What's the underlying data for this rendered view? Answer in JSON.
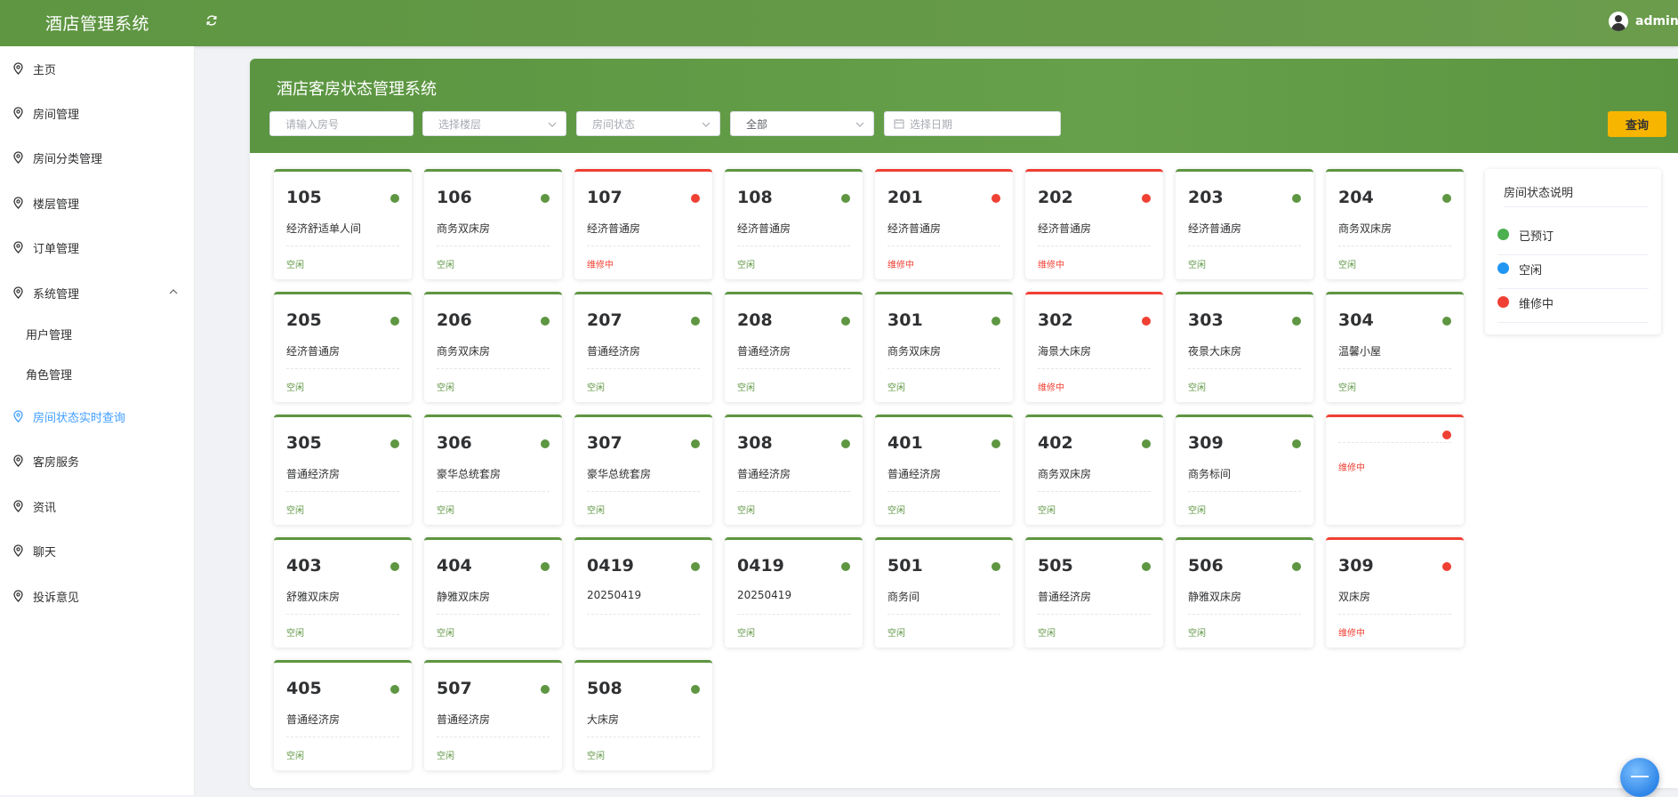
{
  "header": {
    "app_title": "酒店管理系统",
    "username": "admin"
  },
  "sidebar": {
    "items": [
      {
        "label": "主页",
        "active": false
      },
      {
        "label": "房间管理",
        "active": false
      },
      {
        "label": "房间分类管理",
        "active": false
      },
      {
        "label": "楼层管理",
        "active": false
      },
      {
        "label": "订单管理",
        "active": false
      },
      {
        "label": "系统管理",
        "active": false,
        "expanded": true
      },
      {
        "label": "用户管理",
        "active": false,
        "sub": true
      },
      {
        "label": "角色管理",
        "active": false,
        "sub": true
      },
      {
        "label": "房间状态实时查询",
        "active": true
      },
      {
        "label": "客房服务",
        "active": false
      },
      {
        "label": "资讯",
        "active": false
      },
      {
        "label": "聊天",
        "active": false
      },
      {
        "label": "投诉意见",
        "active": false
      }
    ]
  },
  "main": {
    "title": "酒店客房状态管理系统",
    "filters": {
      "room_number_placeholder": "请输入房号",
      "floor_placeholder": "选择楼层",
      "status_placeholder": "房间状态",
      "type_value": "全部",
      "date_placeholder": "选择日期"
    },
    "query_label": "查询"
  },
  "rooms": [
    {
      "number": "105",
      "type": "经济舒适单人间",
      "status": "空闲",
      "state": "free"
    },
    {
      "number": "106",
      "type": "商务双床房",
      "status": "空闲",
      "state": "free"
    },
    {
      "number": "107",
      "type": "经济普通房",
      "status": "维修中",
      "state": "maint"
    },
    {
      "number": "108",
      "type": "经济普通房",
      "status": "空闲",
      "state": "free"
    },
    {
      "number": "201",
      "type": "经济普通房",
      "status": "维修中",
      "state": "maint"
    },
    {
      "number": "202",
      "type": "经济普通房",
      "status": "维修中",
      "state": "maint"
    },
    {
      "number": "203",
      "type": "经济普通房",
      "status": "空闲",
      "state": "free"
    },
    {
      "number": "204",
      "type": "商务双床房",
      "status": "空闲",
      "state": "free"
    },
    {
      "number": "205",
      "type": "经济普通房",
      "status": "空闲",
      "state": "free"
    },
    {
      "number": "206",
      "type": "商务双床房",
      "status": "空闲",
      "state": "free"
    },
    {
      "number": "207",
      "type": "普通经济房",
      "status": "空闲",
      "state": "free"
    },
    {
      "number": "208",
      "type": "普通经济房",
      "status": "空闲",
      "state": "free"
    },
    {
      "number": "301",
      "type": "商务双床房",
      "status": "空闲",
      "state": "free"
    },
    {
      "number": "302",
      "type": "海景大床房",
      "status": "维修中",
      "state": "maint"
    },
    {
      "number": "303",
      "type": "夜景大床房",
      "status": "空闲",
      "state": "free"
    },
    {
      "number": "304",
      "type": "温馨小屋",
      "status": "空闲",
      "state": "free"
    },
    {
      "number": "305",
      "type": "普通经济房",
      "status": "空闲",
      "state": "free"
    },
    {
      "number": "306",
      "type": "豪华总统套房",
      "status": "空闲",
      "state": "free"
    },
    {
      "number": "307",
      "type": "豪华总统套房",
      "status": "空闲",
      "state": "free"
    },
    {
      "number": "308",
      "type": "普通经济房",
      "status": "空闲",
      "state": "free"
    },
    {
      "number": "401",
      "type": "普通经济房",
      "status": "空闲",
      "state": "free"
    },
    {
      "number": "402",
      "type": "商务双床房",
      "status": "空闲",
      "state": "free"
    },
    {
      "number": "309",
      "type": "商务标间",
      "status": "空闲",
      "state": "free"
    },
    {
      "number": "",
      "type": "",
      "status": "维修中",
      "state": "maint",
      "empty": true
    },
    {
      "number": "403",
      "type": "舒雅双床房",
      "status": "空闲",
      "state": "free"
    },
    {
      "number": "404",
      "type": "静雅双床房",
      "status": "空闲",
      "state": "free"
    },
    {
      "number": "0419",
      "type": "20250419",
      "status": "",
      "state": "free"
    },
    {
      "number": "0419",
      "type": "20250419",
      "status": "空闲",
      "state": "free"
    },
    {
      "number": "501",
      "type": "商务间",
      "status": "空闲",
      "state": "free"
    },
    {
      "number": "505",
      "type": "普通经济房",
      "status": "空闲",
      "state": "free"
    },
    {
      "number": "506",
      "type": "静雅双床房",
      "status": "空闲",
      "state": "free"
    },
    {
      "number": "309",
      "type": "双床房",
      "status": "维修中",
      "state": "maint"
    },
    {
      "number": "405",
      "type": "普通经济房",
      "status": "空闲",
      "state": "free"
    },
    {
      "number": "507",
      "type": "普通经济房",
      "status": "空闲",
      "state": "free"
    },
    {
      "number": "508",
      "type": "大床房",
      "status": "空闲",
      "state": "free"
    }
  ],
  "legend": {
    "title": "房间状态说明",
    "items": [
      {
        "label": "已预订",
        "color": "#4caf50"
      },
      {
        "label": "空闲",
        "color": "#2196f3"
      },
      {
        "label": "维修中",
        "color": "#f04034"
      }
    ]
  },
  "colors": {
    "brand_green": "#5e9642",
    "maintenance_red": "#f04034",
    "query_button": "#f7b500",
    "active_menu": "#409eff"
  }
}
